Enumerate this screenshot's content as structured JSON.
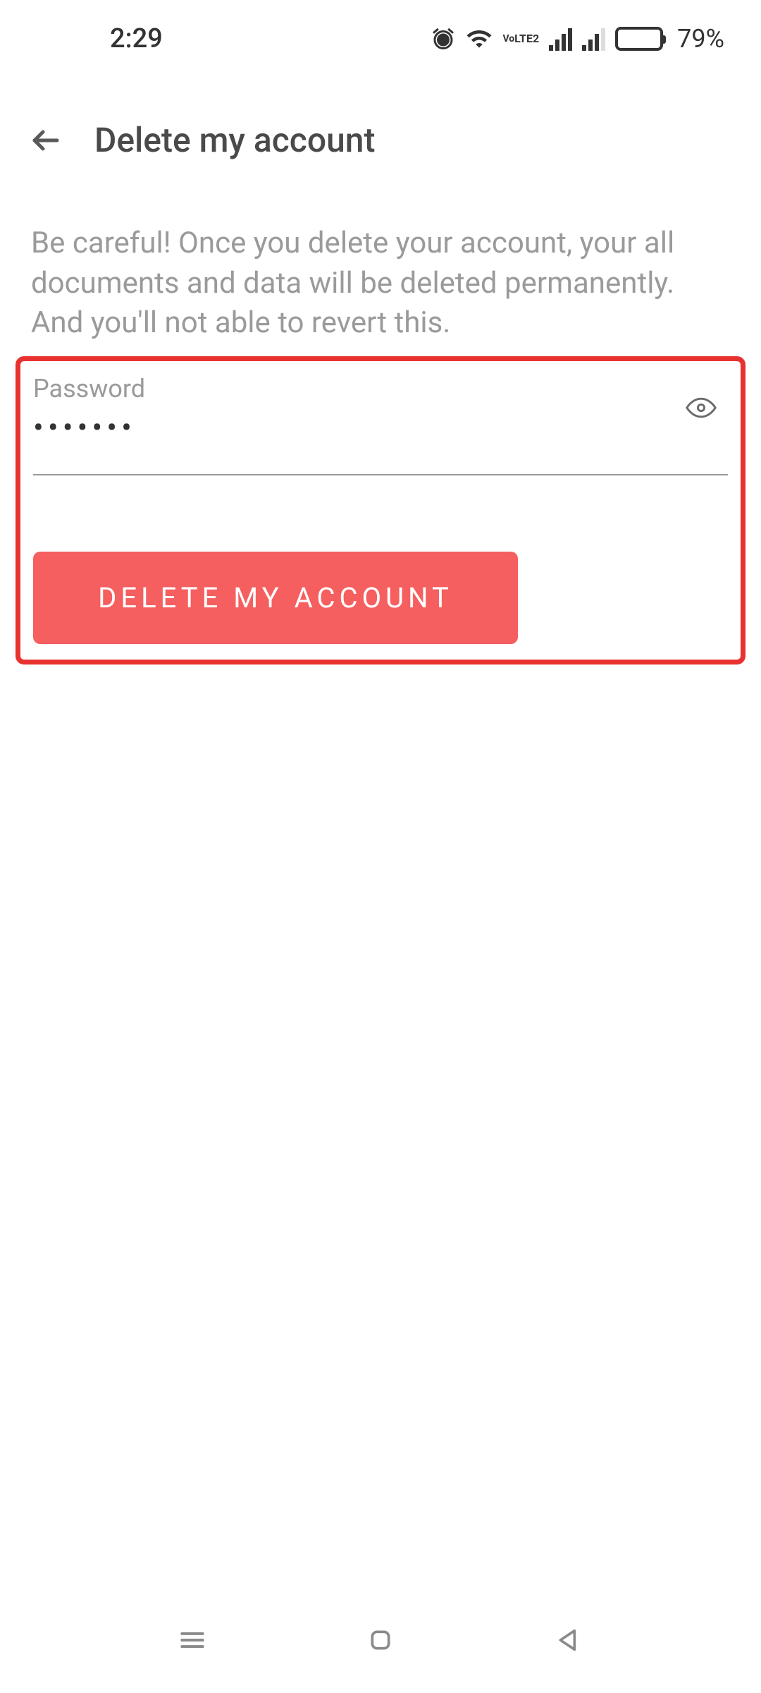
{
  "status": {
    "time": "2:29",
    "battery_pct": "79%",
    "battery_level": 79,
    "volte_label": "Vo\nLTE2"
  },
  "header": {
    "title": "Delete my account"
  },
  "main": {
    "warning": "Be careful! Once you delete your account, your all documents and data will be deleted permanently. And you'll not able to revert this.",
    "password_label": "Password",
    "password_value": "•••••••",
    "delete_button": "DELETE MY ACCOUNT"
  },
  "colors": {
    "highlight_border": "#e8322f",
    "button_bg": "#f65f5f"
  }
}
